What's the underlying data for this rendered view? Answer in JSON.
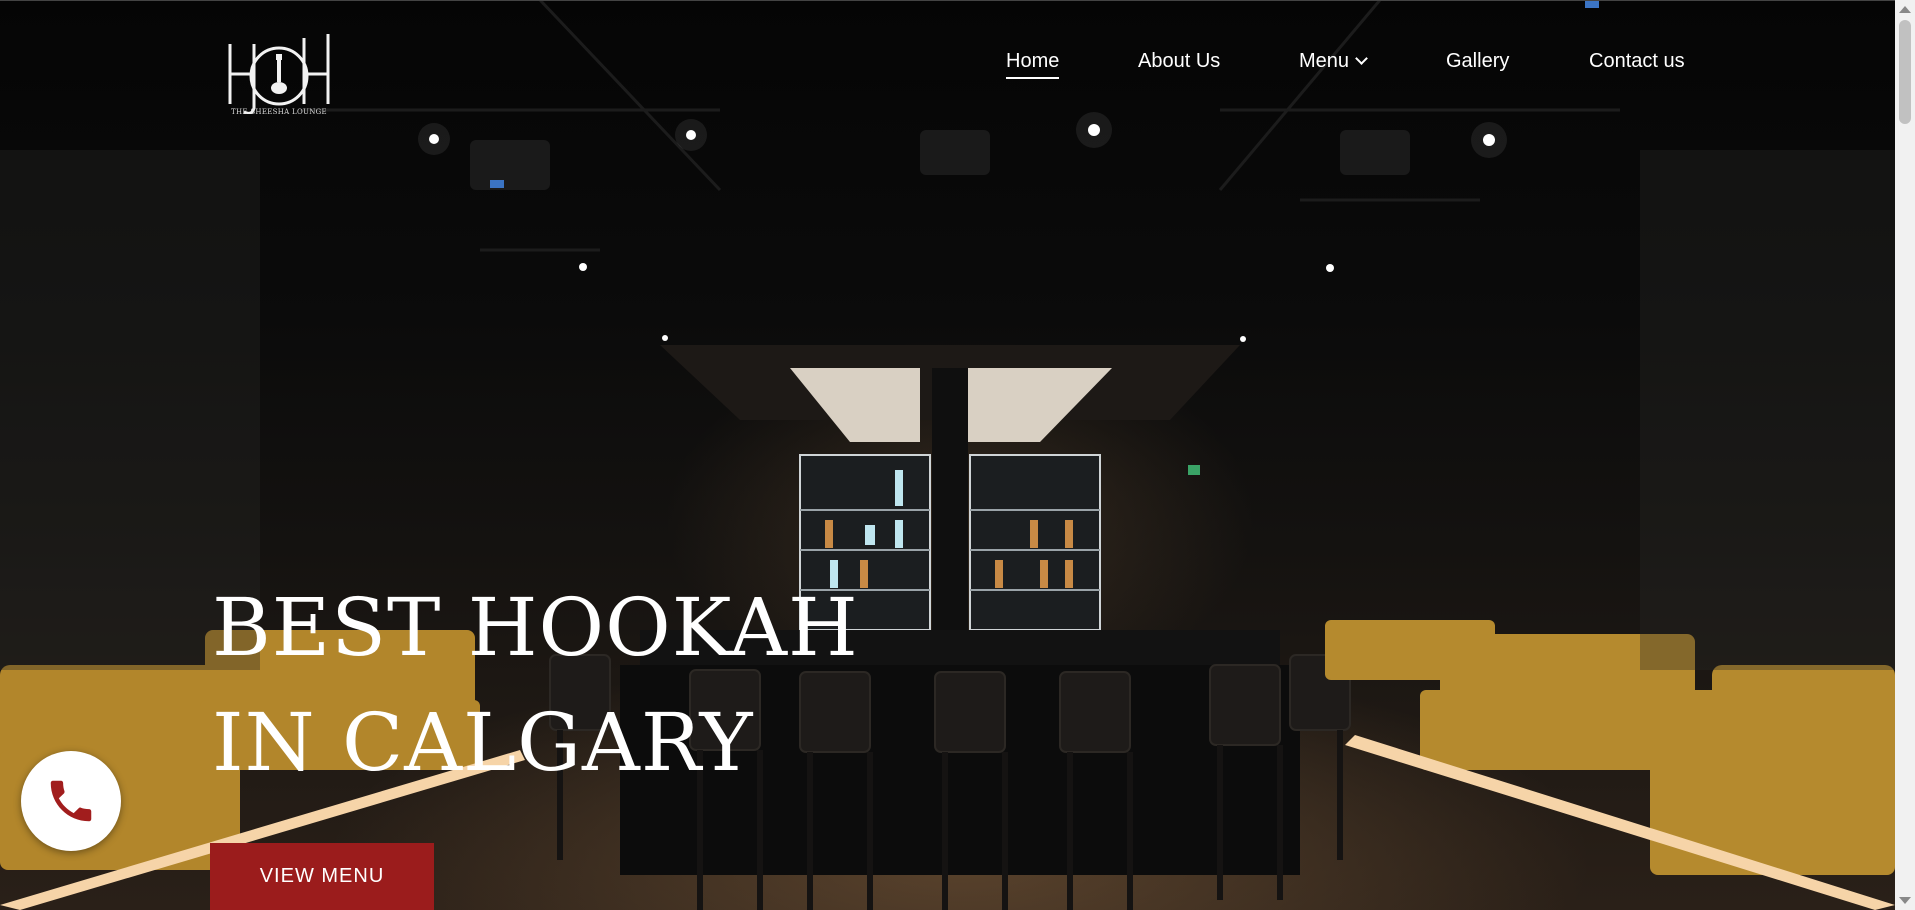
{
  "brand": {
    "logo_monogram": "HOH",
    "logo_tagline": "THE SHEESHA LOUNGE"
  },
  "nav": {
    "items": [
      {
        "label": "Home",
        "active": true
      },
      {
        "label": "About Us",
        "active": false
      },
      {
        "label": "Menu",
        "active": false,
        "has_dropdown": true
      },
      {
        "label": "Gallery",
        "active": false
      },
      {
        "label": "Contact us",
        "active": false
      }
    ]
  },
  "hero": {
    "headline_line1": "BEST HOOKAH",
    "headline_line2": "IN CALGARY",
    "cta_label": "VIEW MENU",
    "background_description_icon": "lounge-bar-photo"
  },
  "floating": {
    "phone_icon": "phone-icon"
  },
  "colors": {
    "accent": "#9b1c1c",
    "phone_icon": "#a11d1d",
    "text": "#ffffff"
  }
}
